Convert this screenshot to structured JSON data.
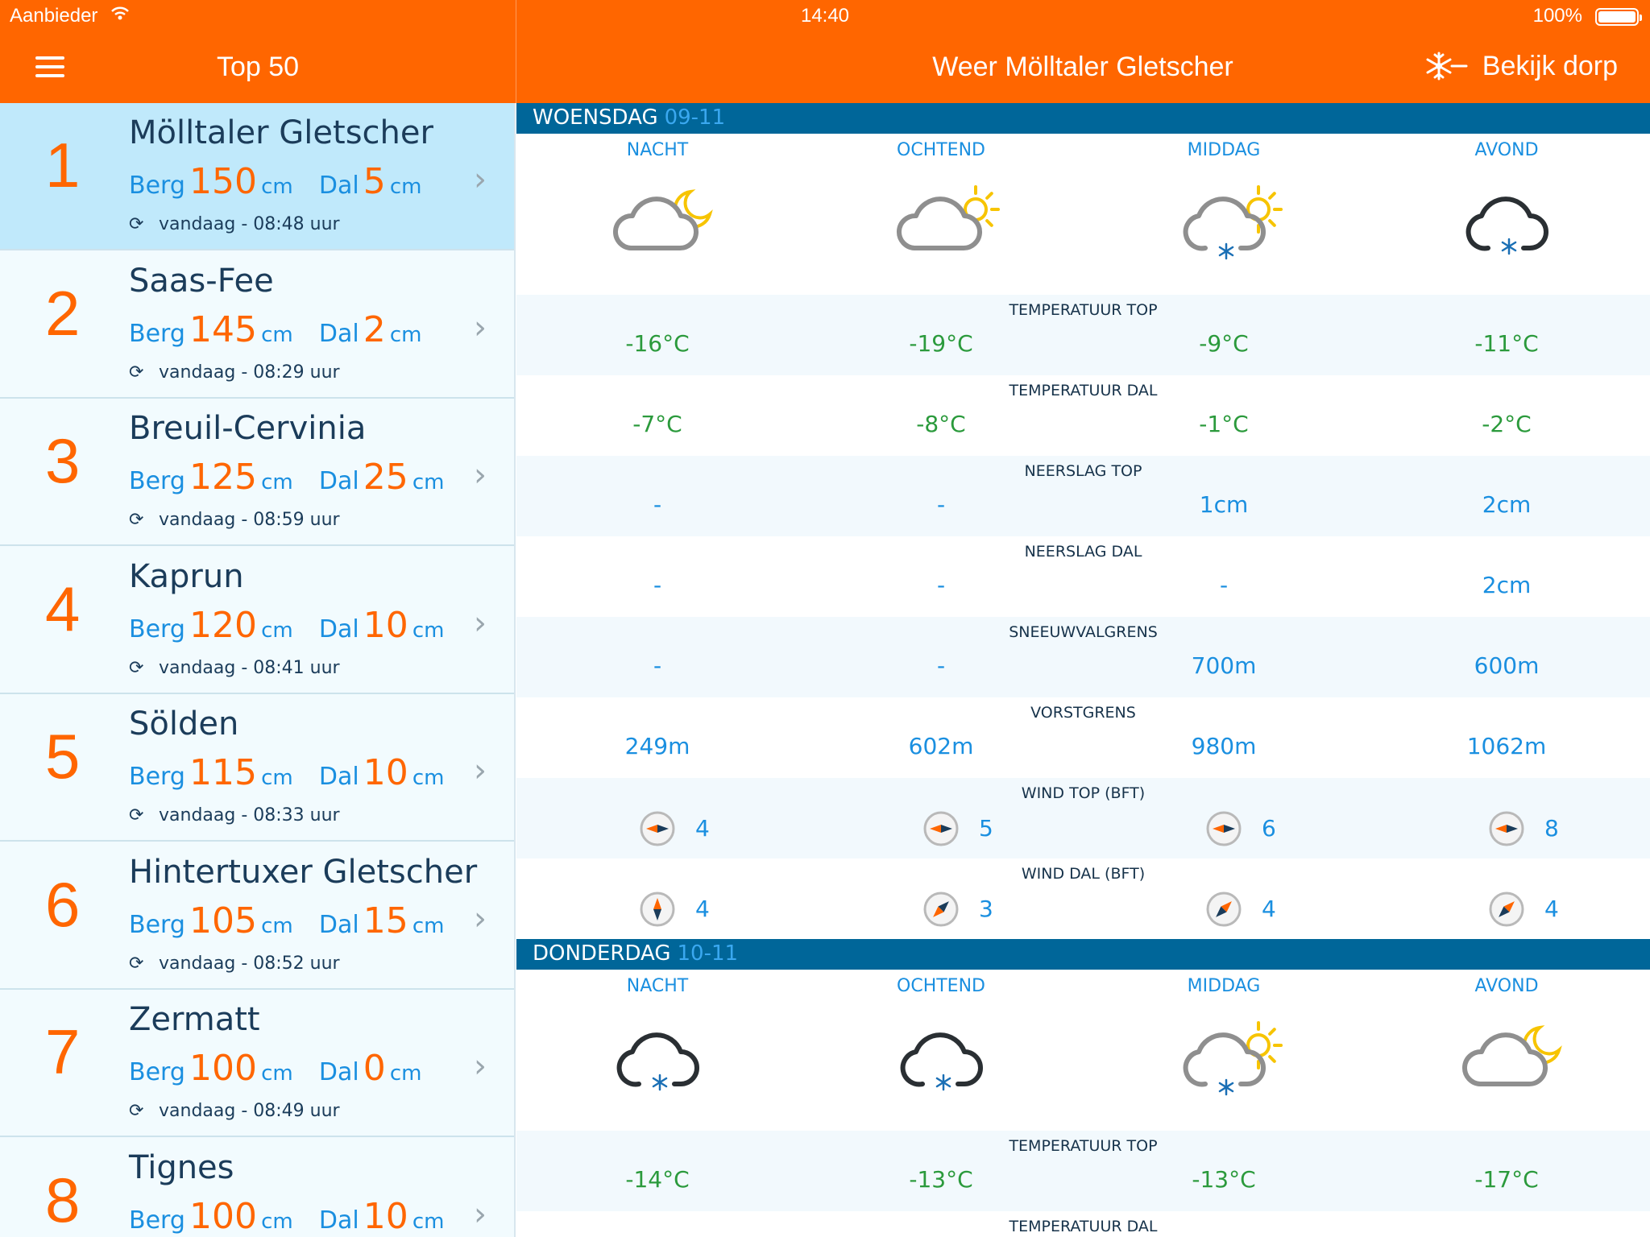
{
  "status": {
    "carrier": "Aanbieder",
    "time": "14:40",
    "battery": "100%"
  },
  "nav": {
    "left_title": "Top 50",
    "right_title": "Weer Mölltaler Gletscher",
    "village_button": "Bekijk dorp"
  },
  "list": [
    {
      "rank": "1",
      "name": "Mölltaler Gletscher",
      "berg": "150",
      "dal": "5",
      "updated": "vandaag - 08:48 uur"
    },
    {
      "rank": "2",
      "name": "Saas-Fee",
      "berg": "145",
      "dal": "2",
      "updated": "vandaag - 08:29 uur"
    },
    {
      "rank": "3",
      "name": "Breuil-Cervinia",
      "berg": "125",
      "dal": "25",
      "updated": "vandaag - 08:59 uur"
    },
    {
      "rank": "4",
      "name": "Kaprun",
      "berg": "120",
      "dal": "10",
      "updated": "vandaag - 08:41 uur"
    },
    {
      "rank": "5",
      "name": "Sölden",
      "berg": "115",
      "dal": "10",
      "updated": "vandaag - 08:33 uur"
    },
    {
      "rank": "6",
      "name": "Hintertuxer Gletscher",
      "berg": "105",
      "dal": "15",
      "updated": "vandaag - 08:52 uur"
    },
    {
      "rank": "7",
      "name": "Zermatt",
      "berg": "100",
      "dal": "0",
      "updated": "vandaag - 08:49 uur"
    },
    {
      "rank": "8",
      "name": "Tignes",
      "berg": "100",
      "dal": "10",
      "updated": ""
    }
  ],
  "labels": {
    "berg": "Berg",
    "dal": "Dal",
    "unit": "cm"
  },
  "parts": [
    "NACHT",
    "OCHTEND",
    "MIDDAG",
    "AVOND"
  ],
  "days": [
    {
      "name": "WOENSDAG",
      "date": "09-11",
      "icons": [
        "cloud-moon-icon",
        "cloud-sun-icon",
        "cloud-sun-snow-icon",
        "cloud-snow-icon"
      ],
      "rows": [
        {
          "label": "TEMPERATUUR TOP",
          "values": [
            "-16°C",
            "-19°C",
            "-9°C",
            "-11°C"
          ]
        },
        {
          "label": "TEMPERATUUR DAL",
          "values": [
            "-7°C",
            "-8°C",
            "-1°C",
            "-2°C"
          ]
        },
        {
          "label": "NEERSLAG TOP",
          "values": [
            "-",
            "-",
            "1cm",
            "2cm"
          ]
        },
        {
          "label": "NEERSLAG DAL",
          "values": [
            "-",
            "-",
            "-",
            "2cm"
          ]
        },
        {
          "label": "SNEEUWVALGRENS",
          "values": [
            "-",
            "-",
            "700m",
            "600m"
          ]
        },
        {
          "label": "VORSTGRENS",
          "values": [
            "249m",
            "602m",
            "980m",
            "1062m"
          ]
        },
        {
          "label": "WIND TOP (BFT)",
          "values": [
            "4",
            "5",
            "6",
            "8"
          ]
        },
        {
          "label": "WIND DAL (BFT)",
          "values": [
            "4",
            "3",
            "4",
            "4"
          ]
        }
      ]
    },
    {
      "name": "DONDERDAG",
      "date": "10-11",
      "icons": [
        "cloud-snow-icon",
        "cloud-snow-icon",
        "cloud-sun-snow-icon",
        "cloud-moon-icon"
      ],
      "rows": [
        {
          "label": "TEMPERATUUR TOP",
          "values": [
            "-14°C",
            "-13°C",
            "-13°C",
            "-17°C"
          ]
        },
        {
          "label": "TEMPERATUUR DAL",
          "values": []
        }
      ]
    }
  ]
}
